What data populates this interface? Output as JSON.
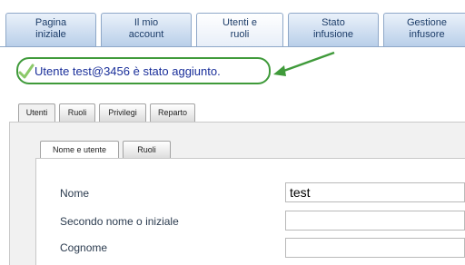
{
  "top_tabs": [
    {
      "label": "Pagina\niniziale",
      "active": false
    },
    {
      "label": "Il mio\naccount",
      "active": false
    },
    {
      "label": "Utenti e\nruoli",
      "active": true
    },
    {
      "label": "Stato\ninfusione",
      "active": false
    },
    {
      "label": "Gestione\ninfusore",
      "active": false
    }
  ],
  "message": {
    "text": "Utente test@3456 è stato aggiunto.",
    "icon": "check-icon",
    "color": "#1a2f9a",
    "border_color": "#3f9a3a"
  },
  "sub_tabs": [
    {
      "label": "Utenti",
      "active": true
    },
    {
      "label": "Ruoli",
      "active": false
    },
    {
      "label": "Privilegi",
      "active": false
    },
    {
      "label": "Reparto",
      "active": false
    }
  ],
  "inner_tabs": [
    {
      "label": "Nome e utente",
      "active": true
    },
    {
      "label": "Ruoli",
      "active": false
    }
  ],
  "form": {
    "nome_label": "Nome",
    "nome_value": "test",
    "secondo_label": "Secondo nome o iniziale",
    "secondo_value": "",
    "cognome_label": "Cognome",
    "cognome_value": ""
  }
}
